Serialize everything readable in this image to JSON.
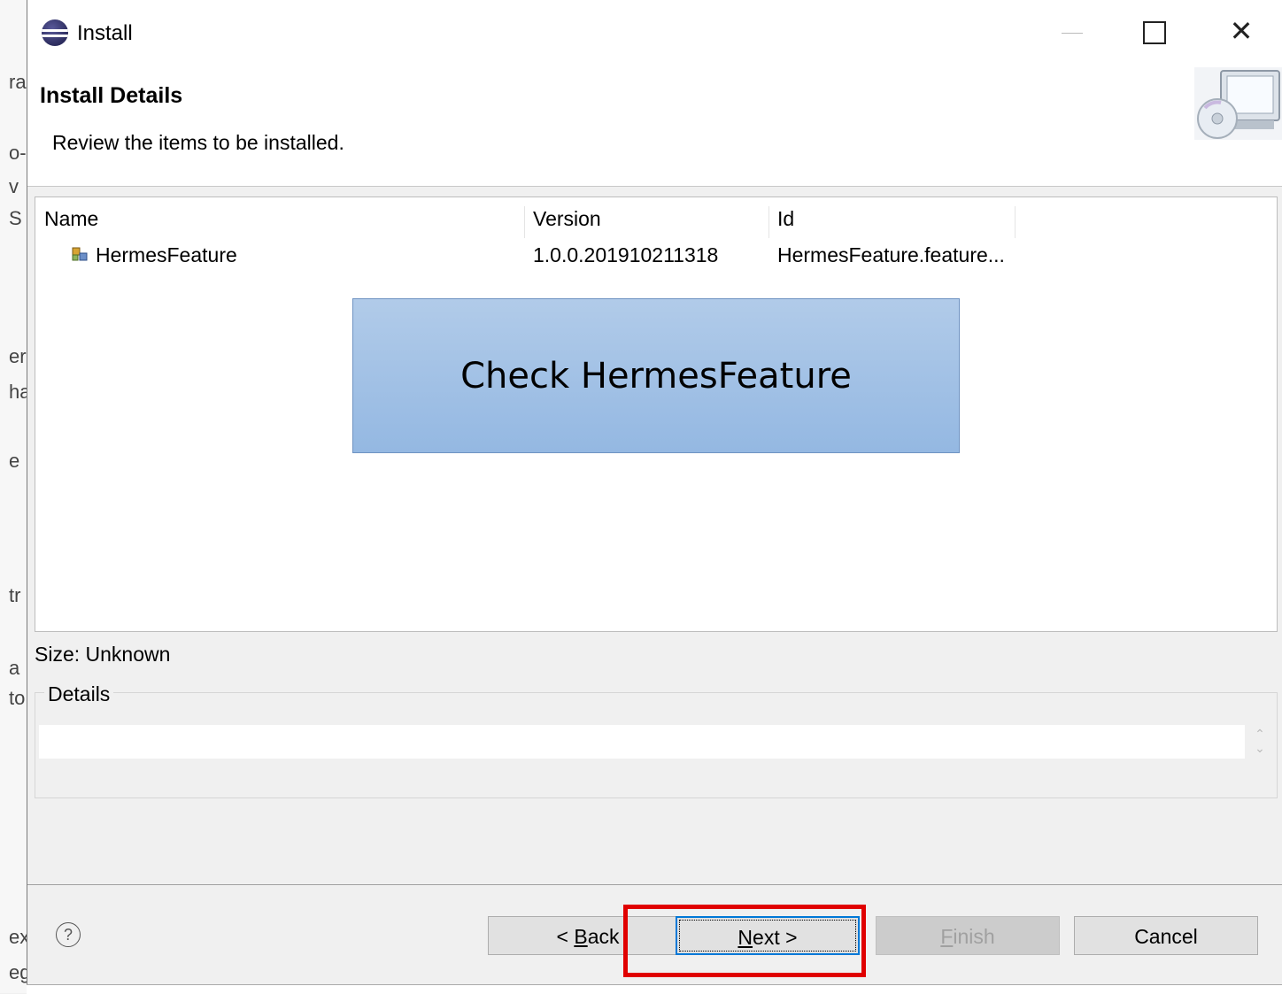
{
  "background": {
    "fragments": [
      "ra",
      "o-",
      "v",
      "S",
      "er",
      "ha",
      "e",
      "tr",
      "a",
      "to",
      "ex",
      "eg"
    ]
  },
  "window": {
    "title": "Install",
    "close_glyph": "✕"
  },
  "header": {
    "title": "Install Details",
    "description": "Review the items to be installed."
  },
  "table": {
    "columns": [
      "Name",
      "Version",
      "Id"
    ],
    "rows": [
      {
        "name": "HermesFeature",
        "version": "1.0.0.201910211318",
        "id": "HermesFeature.feature..."
      }
    ]
  },
  "callout": {
    "text": "Check HermesFeature"
  },
  "size": "Size: Unknown",
  "details": {
    "label": "Details",
    "value": ""
  },
  "help_glyph": "?",
  "buttons": {
    "back": {
      "prefix": "< ",
      "mnemonic": "B",
      "rest": "ack"
    },
    "next": {
      "mnemonic": "N",
      "rest": "ext >"
    },
    "finish": {
      "mnemonic": "F",
      "rest": "inish"
    },
    "cancel": "Cancel"
  },
  "colors": {
    "accent": "#0078d7",
    "highlight": "#e00000",
    "callout_fill": "#a3c1e6"
  },
  "icons": {
    "app": "eclipse-icon",
    "banner": "monitor-cd-icon",
    "feature": "feature-icon",
    "help": "help-icon"
  }
}
